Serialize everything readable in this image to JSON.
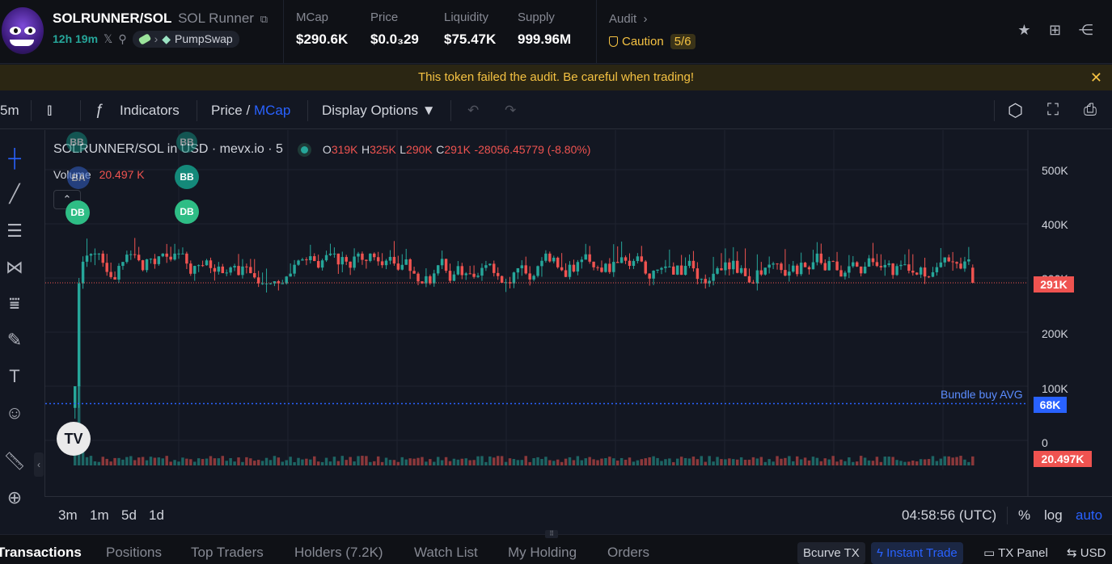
{
  "header": {
    "pair": "SOLRUNNER/SOL",
    "name": "SOL Runner",
    "copy_icon": "copy-icon",
    "age": "12h 19m",
    "dex": "PumpSwap",
    "stats": [
      {
        "label": "MCap",
        "value": "$290.6K"
      },
      {
        "label": "Price",
        "value": "$0.0₃29"
      },
      {
        "label": "Liquidity",
        "value": "$75.47K"
      },
      {
        "label": "Supply",
        "value": "999.96M"
      }
    ],
    "audit_label": "Audit",
    "audit_status": "Caution",
    "audit_score": "5/6"
  },
  "warning": {
    "text": "This token failed the audit. Be careful when trading!"
  },
  "toolbar": {
    "interval": "5m",
    "indicators": "Indicators",
    "price": "Price",
    "slash": "/",
    "mcap": "MCap",
    "display_options": "Display Options"
  },
  "chart_legend": {
    "symbol": "SOLRUNNER/SOL in USD · mevx.io · 5",
    "o_label": "O",
    "o": "319K",
    "h_label": "H",
    "h": "325K",
    "l_label": "L",
    "l": "290K",
    "c_label": "C",
    "c": "291K",
    "change": "-28056.45779 (-8.80%)",
    "volume_label": "Volume",
    "volume_value": "20.497 K"
  },
  "markers": {
    "db": "DB",
    "bb": "BB",
    "ba": "BA"
  },
  "axis": {
    "ticks": [
      "500K",
      "400K",
      "300K",
      "200K",
      "100K",
      "0"
    ],
    "last_price": "291K",
    "bundle_label": "Bundle buy AVG",
    "bundle_value": "68K",
    "volume_value": "20.497K"
  },
  "bottom": {
    "ranges": [
      "3m",
      "1m",
      "5d",
      "1d"
    ],
    "time": "04:58:56 (UTC)",
    "percent": "%",
    "log": "log",
    "auto": "auto"
  },
  "tabs": {
    "items": [
      "Transactions",
      "Positions",
      "Top Traders",
      "Holders (7.2K)",
      "Watch List",
      "My Holding",
      "Orders"
    ],
    "bcurve": "Bcurve TX",
    "instant": "Instant Trade",
    "txpanel": "TX Panel",
    "usd": "USD"
  },
  "colors": {
    "up": "#26a69a",
    "down": "#ef5350",
    "accent": "#2962ff",
    "warning": "#f5c242"
  },
  "chart_data": {
    "type": "candlestick",
    "ylim": [
      0,
      520000
    ],
    "last_price": 291000,
    "bundle_buy_avg": 68000,
    "first_candles": [
      {
        "o": 60000,
        "h": 100000,
        "l": 40000,
        "c": 100000
      },
      {
        "o": 100000,
        "h": 300000,
        "l": 60000,
        "c": 290000
      },
      {
        "o": 290000,
        "h": 340000,
        "l": 280000,
        "c": 330000
      }
    ],
    "typical_range": [
      290000,
      340000
    ],
    "max_high": 420000,
    "min_low": 250000
  }
}
